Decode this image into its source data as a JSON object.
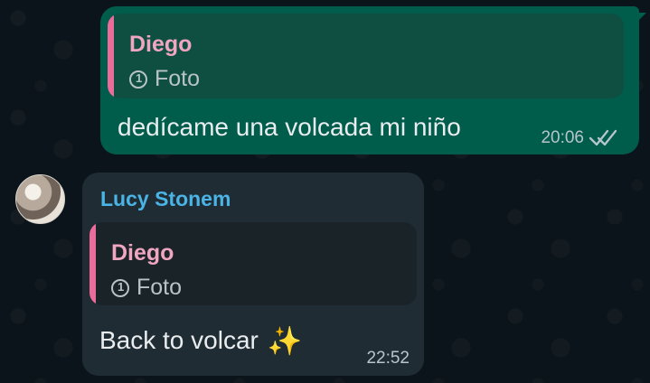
{
  "chat": {
    "outgoing": {
      "quoted_author": "Diego",
      "quoted_media": "Foto",
      "message": "dedícame una volcada mi niño",
      "time": "20:06",
      "status": "read"
    },
    "incoming": {
      "sender": "Lucy Stonem",
      "quoted_author": "Diego",
      "quoted_media": "Foto",
      "message": "Back to volcar",
      "emoji": "✨",
      "time": "22:52"
    }
  },
  "colors": {
    "background": "#0b141a",
    "outgoing_bubble": "#005c4b",
    "incoming_bubble": "#202c33",
    "quote_accent": "#ea6c9a",
    "sender_name": "#4ab4e6"
  },
  "icons": {
    "quoted_media": "view-once-photo-icon",
    "read_status": "double-check-icon",
    "avatar": "contact-avatar"
  }
}
